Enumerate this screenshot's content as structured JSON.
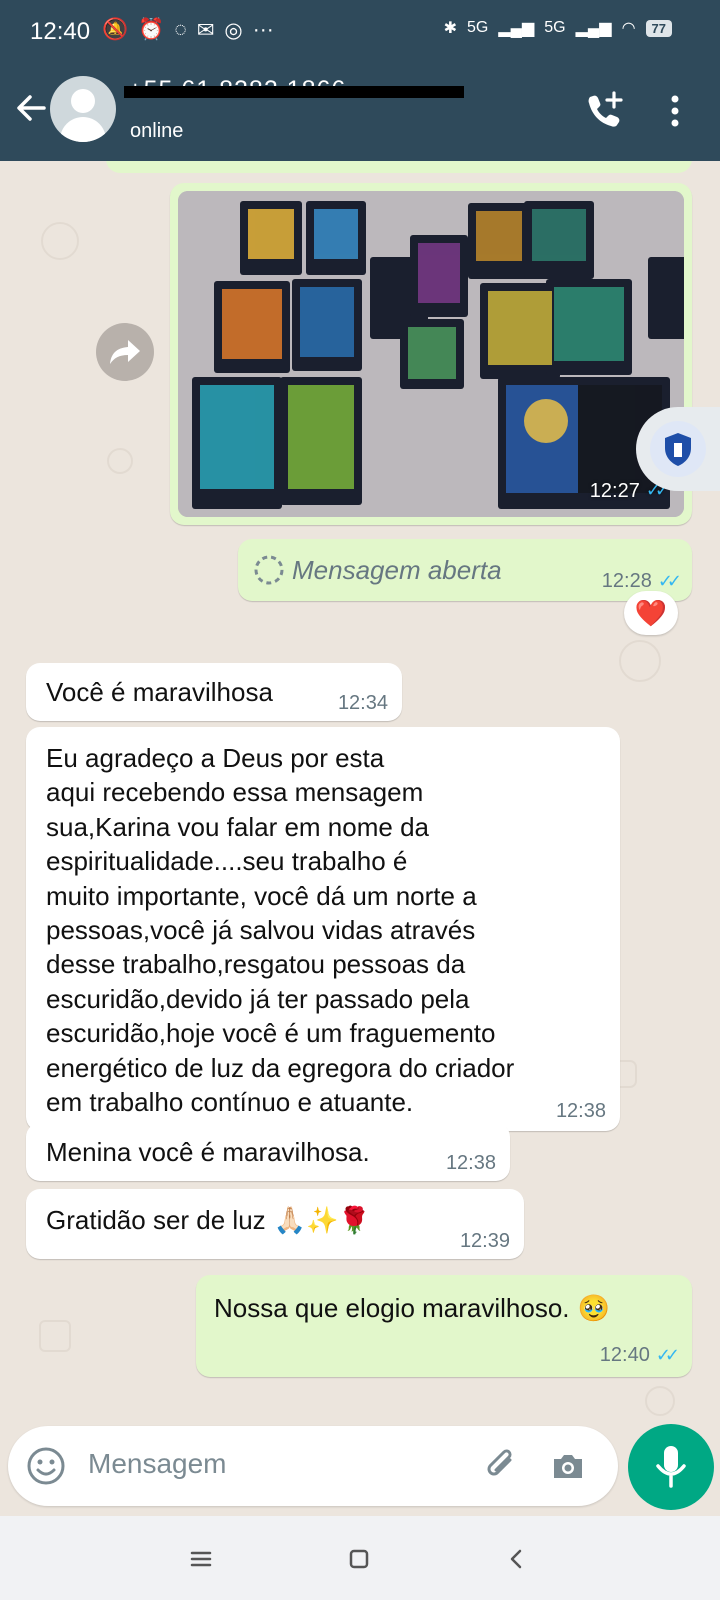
{
  "status_bar": {
    "time": "12:40",
    "signal_1": "5G",
    "signal_2": "5G",
    "battery": "77",
    "icons": [
      "notifications-off-icon",
      "alarm-icon",
      "whatsapp-icon",
      "gmail-icon",
      "instagram-icon",
      "more-icon",
      "bluetooth-icon",
      "signal-icon",
      "wifi-icon",
      "battery-icon"
    ]
  },
  "header": {
    "contact": "+55 61 8282 1866",
    "presence": "online",
    "icons": [
      "back-arrow-icon",
      "add-call-icon",
      "more-vert-icon"
    ]
  },
  "chat": {
    "image_message": {
      "time": "12:27",
      "status": "read",
      "alt": "tarot cards"
    },
    "opened_message": {
      "label": "Mensagem aberta",
      "time": "12:28",
      "reaction": "❤️"
    },
    "messages": [
      {
        "text": "Você é maravilhosa",
        "time": "12:34"
      },
      {
        "text": "Eu agradeço a Deus por esta\naqui recebendo essa mensagem\nsua,Karina vou falar em nome da\nespiritualidade....seu trabalho é\nmuito importante, você dá um norte a\npessoas,você já salvou vidas através\ndesse trabalho,resgatou pessoas da\nescuridão,devido já ter passado pela\nescuridão,hoje  você é um fraguemento\nenergético de luz da egregora do criador\nem trabalho contínuo e atuante.",
        "time": "12:38"
      },
      {
        "text": "Menina você é maravilhosa.",
        "time": "12:38"
      },
      {
        "text": "Gratidão ser de luz",
        "emojis": "🙏🏻✨🌹",
        "time": "12:39"
      }
    ],
    "outgoing": {
      "text": "Nossa que elogio maravilhoso.",
      "emoji": "🥹",
      "time": "12:40"
    }
  },
  "composer": {
    "placeholder": "Mensagem"
  },
  "colors": {
    "header": "#2f4a5b",
    "out_bubble": "#e2f7cb",
    "in_bubble": "#ffffff",
    "accent": "#00a884",
    "read_ticks": "#34b7f1"
  }
}
